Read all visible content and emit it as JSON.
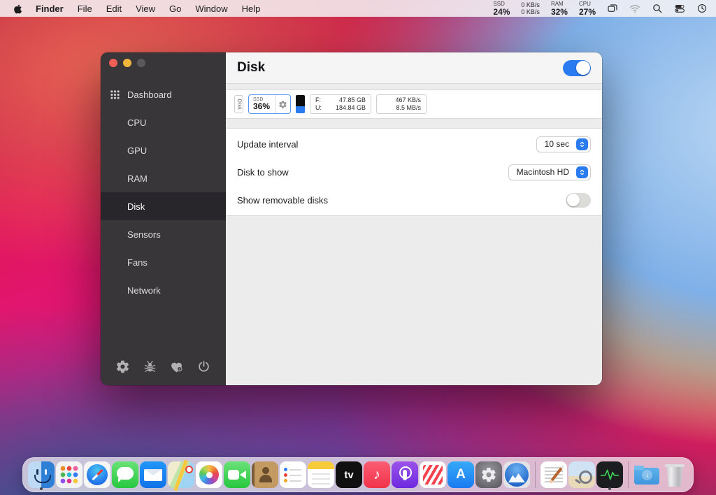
{
  "menu_bar": {
    "app_name": "Finder",
    "menus": [
      "File",
      "Edit",
      "View",
      "Go",
      "Window",
      "Help"
    ],
    "status_items": {
      "ssd": {
        "label": "SSD",
        "value": "24%"
      },
      "network": {
        "line1": "0 KB/s",
        "line2": "0 KB/s"
      },
      "ram": {
        "label": "RAM",
        "value": "32%"
      },
      "cpu": {
        "label": "CPU",
        "value": "27%"
      }
    },
    "icons": [
      "mission-control",
      "wifi",
      "search",
      "control-center",
      "clock"
    ]
  },
  "window": {
    "header": {
      "title": "Disk",
      "module_enabled": true
    },
    "sidebar": {
      "items": [
        {
          "label": "Dashboard"
        },
        {
          "label": "CPU"
        },
        {
          "label": "GPU"
        },
        {
          "label": "RAM"
        },
        {
          "label": "Disk",
          "selected": true
        },
        {
          "label": "Sensors"
        },
        {
          "label": "Fans"
        },
        {
          "label": "Network"
        }
      ],
      "footer_icons": [
        "settings",
        "bug-report",
        "donate",
        "quit"
      ]
    },
    "widgets": {
      "vertical_label": "Disk",
      "percent": {
        "label": "SSD",
        "value": "36%"
      },
      "capacity": {
        "free_label": "F:",
        "free_value": "47.85 GB",
        "used_label": "U:",
        "used_value": "184.84 GB"
      },
      "speed": {
        "line1": "467 KB/s",
        "line2": "8.5 MB/s"
      }
    },
    "settings": {
      "rows": [
        {
          "label": "Update interval",
          "value": "10 sec"
        },
        {
          "label": "Disk to show",
          "value": "Macintosh HD"
        },
        {
          "label": "Show removable disks",
          "enabled": false
        }
      ]
    }
  },
  "dock": {
    "items": [
      "Finder",
      "Launchpad",
      "Safari",
      "Messages",
      "Mail",
      "Maps",
      "Photos",
      "FaceTime",
      "Contacts",
      "Reminders",
      "Notes",
      "TV",
      "Music",
      "Podcasts",
      "News",
      "App Store",
      "System Preferences",
      "Install macOS",
      "TextEdit",
      "Preview",
      "Activity Monitor",
      "Downloads",
      "Trash"
    ],
    "glyphs": {
      "tv": "tv",
      "app_store": "A",
      "music": "♪",
      "downloads": "↓"
    },
    "running": [
      "Finder",
      "Activity Monitor"
    ]
  },
  "colors": {
    "accent": "#2a7bf0",
    "selected_widget_border": "#5795f3",
    "sidebar_bg": "#39363a"
  }
}
